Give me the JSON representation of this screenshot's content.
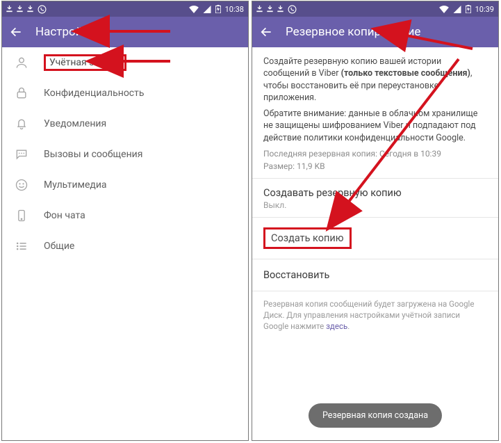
{
  "status": {
    "time": "10:38",
    "timeRight": "10:39"
  },
  "left": {
    "title": "Настройки",
    "items": [
      {
        "id": "account",
        "label": "Учётная запись"
      },
      {
        "id": "privacy",
        "label": "Конфиденциальность"
      },
      {
        "id": "notify",
        "label": "Уведомления"
      },
      {
        "id": "calls",
        "label": "Вызовы и сообщения"
      },
      {
        "id": "media",
        "label": "Мультимедиа"
      },
      {
        "id": "bg",
        "label": "Фон чата"
      },
      {
        "id": "general",
        "label": "Общие"
      }
    ]
  },
  "right": {
    "title": "Резервное копирование",
    "body1_a": "Создайте резервную копию вашей истории сообщений в Viber ",
    "body1_b": "(только текстовые сообщения)",
    "body1_c": ", чтобы восстановить её при переустановке приложения.",
    "body2": "Обратите внимание: данные в облачном хранилище не защищены шифрованием Viber и подпадают под действие политики конфиденциальности Google.",
    "meta1": "Последняя резервная копия: Сегодня в 10:39",
    "meta2": "Размер: 11,9 KB",
    "sectionAuto": "Создавать резервную копию",
    "sectionAutoSub": "Выкл.",
    "sectionNow": "Создать копию",
    "sectionRestore": "Восстановить",
    "note_a": "Резервная копия сообщений будет загружена на Google Диск. Для управления настройками учётной записи Google нажмите ",
    "note_link": "здесь",
    "note_b": ".",
    "snackbar": "Резервная копия создана"
  }
}
